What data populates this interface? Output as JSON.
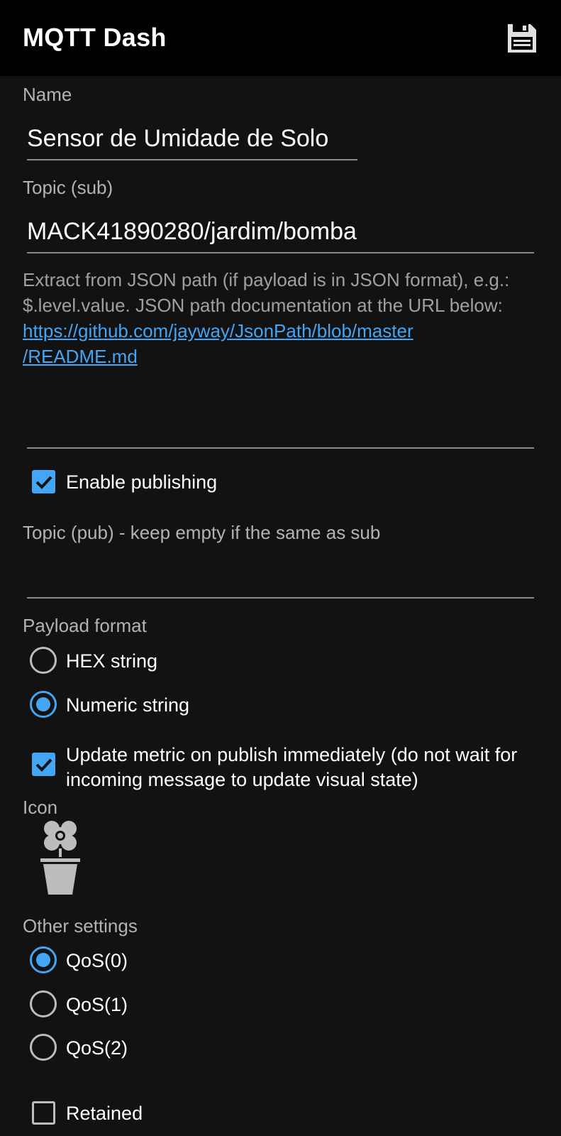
{
  "appbar": {
    "title": "MQTT Dash",
    "save_icon": "floppy-disk-icon"
  },
  "name": {
    "label": "Name",
    "value": "Sensor de Umidade de Solo"
  },
  "topic_sub": {
    "label": "Topic (sub)",
    "value": "MACK41890280/jardim/bomba"
  },
  "json_path": {
    "help": "Extract from JSON path (if payload is in JSON format), e.g.: $.level.value. JSON path documentation at the URL below:",
    "link_line1": "https://github.com/jayway/JsonPath/blob/master",
    "link_line2": "/README.md",
    "value": ""
  },
  "enable_publishing": {
    "label": "Enable publishing",
    "checked": true
  },
  "topic_pub": {
    "placeholder": "Topic (pub) - keep empty if the same as sub",
    "value": ""
  },
  "payload_format": {
    "label": "Payload format",
    "options": [
      "HEX string",
      "Numeric string"
    ],
    "selected": "Numeric string"
  },
  "update_metric": {
    "label": "Update metric on publish immediately (do not wait for incoming message to update visual state)",
    "checked": true
  },
  "icon": {
    "label": "Icon",
    "name": "flower-pot-icon"
  },
  "other_settings": {
    "label": "Other settings",
    "qos_options": [
      "QoS(0)",
      "QoS(1)",
      "QoS(2)"
    ],
    "selected": "QoS(0)"
  },
  "retained": {
    "label": "Retained",
    "checked": false
  },
  "colors": {
    "accent": "#42a5f5",
    "background": "#121212",
    "appbar": "#000000"
  }
}
